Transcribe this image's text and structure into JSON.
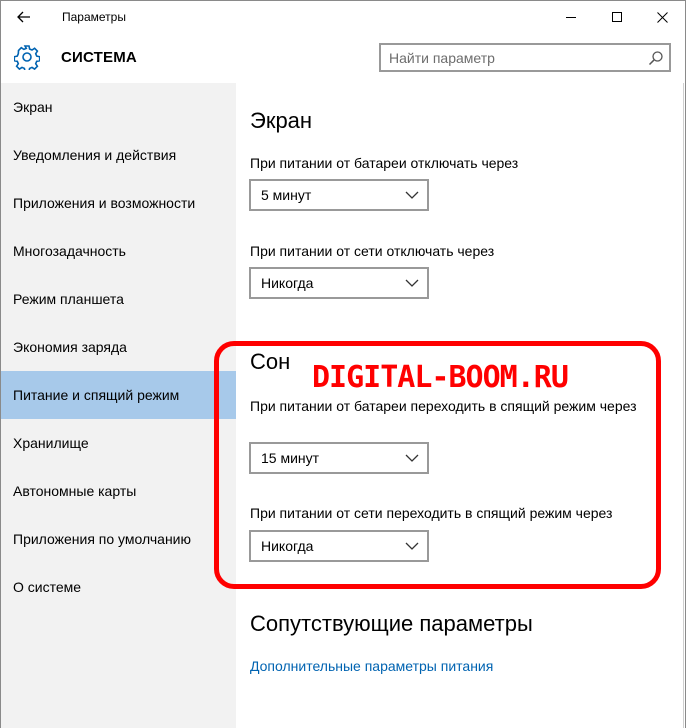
{
  "window": {
    "title": "Параметры",
    "back_icon": "arrow-left-icon",
    "controls": [
      "minimize-icon",
      "maximize-icon",
      "close-icon"
    ]
  },
  "header": {
    "icon": "gear-icon",
    "title": "СИСТЕМА",
    "search_placeholder": "Найти параметр",
    "search_icon": "search-icon"
  },
  "sidebar": {
    "items": [
      {
        "label": "Экран"
      },
      {
        "label": "Уведомления и действия"
      },
      {
        "label": "Приложения и возможности"
      },
      {
        "label": "Многозадачность"
      },
      {
        "label": "Режим планшета"
      },
      {
        "label": "Экономия заряда"
      },
      {
        "label": "Питание и спящий режим",
        "active": true
      },
      {
        "label": "Хранилище"
      },
      {
        "label": "Автономные карты"
      },
      {
        "label": "Приложения по умолчанию"
      },
      {
        "label": "О системе"
      }
    ]
  },
  "main": {
    "screen_section": {
      "title": "Экран",
      "battery_label": "При питании от батареи отключать через",
      "battery_value": "5 минут",
      "power_label": "При питании от сети отключать через",
      "power_value": "Никогда"
    },
    "sleep_section": {
      "title": "Сон",
      "battery_label": "При питании от батареи переходить в спящий режим через",
      "battery_value": "15 минут",
      "power_label": "При питании от сети переходить в спящий режим через",
      "power_value": "Никогда"
    },
    "related_section": {
      "title": "Сопутствующие параметры",
      "link": "Дополнительные параметры питания"
    }
  },
  "overlay": {
    "watermark": "DIGITAL-BOOM.RU",
    "highlight_color": "#ff0000"
  },
  "colors": {
    "accent_selected": "#a7c9ea",
    "sidebar_bg": "#f2f2f2",
    "link": "#0063b1"
  }
}
